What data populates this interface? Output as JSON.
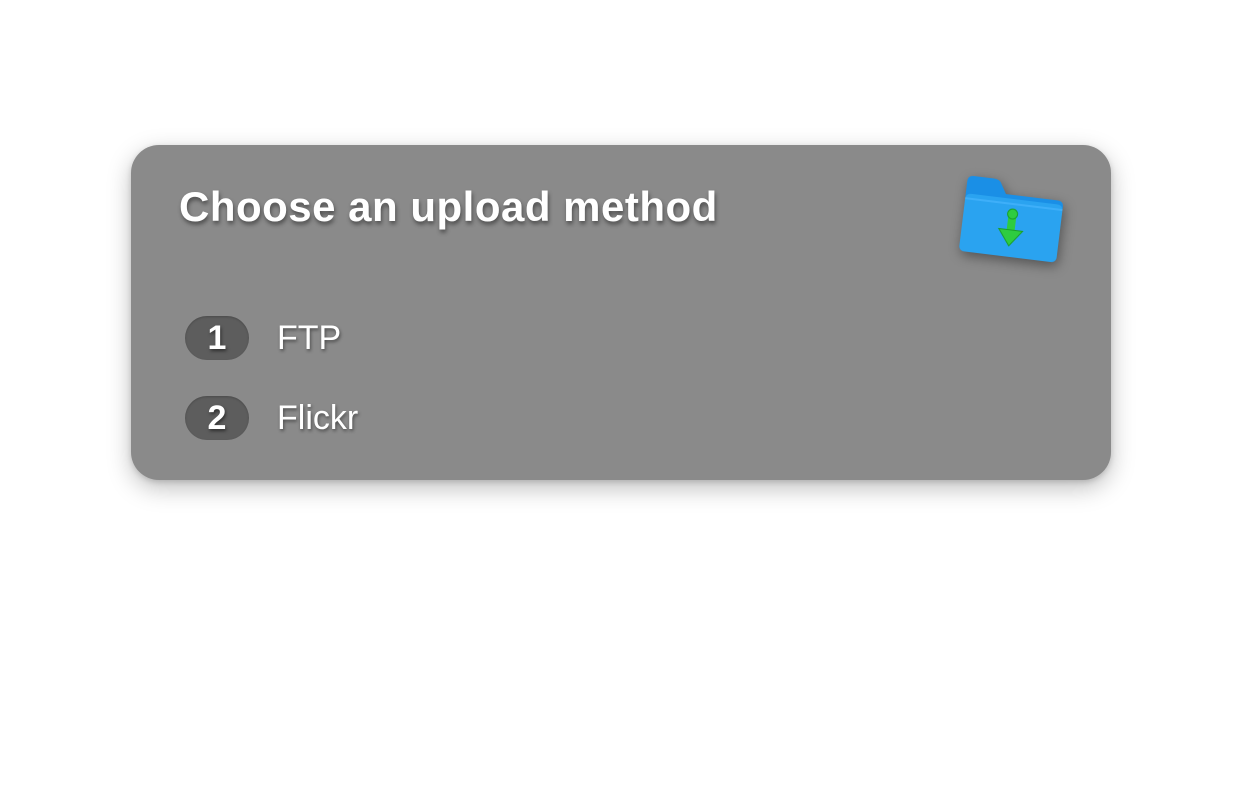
{
  "panel": {
    "title": "Choose an upload method",
    "options": [
      {
        "number": "1",
        "label": "FTP"
      },
      {
        "number": "2",
        "label": "Flickr"
      }
    ]
  }
}
